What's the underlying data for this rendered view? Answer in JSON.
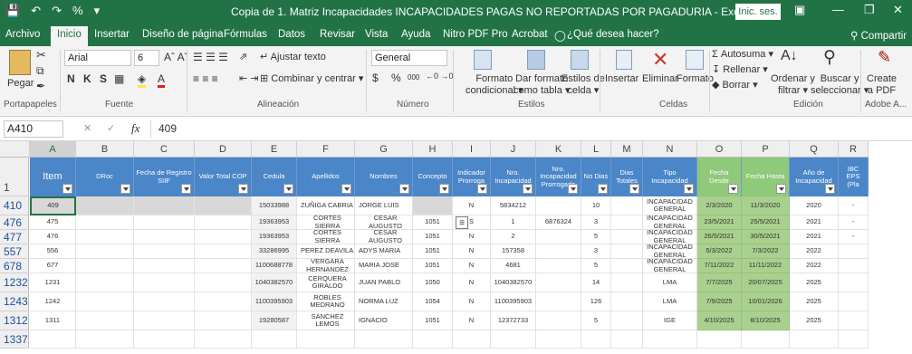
{
  "titlebar": {
    "title": "Copia de 1. Matriz Incapacidades INCAPACIDADES PAGAS NO REPORTADAS POR PAGADURIA  -  Excel",
    "signin": "Inic. ses."
  },
  "ribbon_tabs": [
    "Archivo",
    "Inicio",
    "Insertar",
    "Diseño de página",
    "Fórmulas",
    "Datos",
    "Revisar",
    "Vista",
    "Ayuda",
    "Nitro PDF Pro",
    "Acrobat",
    "¿Qué desea hacer?",
    "Compartir"
  ],
  "ribbon": {
    "paste": "Pegar",
    "font_name": "Arial",
    "font_size": "6",
    "bold_italic_underline": "N K S",
    "wrap_text": "Ajustar texto",
    "merge_center": "Combinar y centrar",
    "number_format": "General",
    "currency": "$",
    "percent": "%",
    "thousands": "000",
    "cond_format": [
      "Formato",
      "condicional"
    ],
    "format_table": [
      "Dar formato",
      "como tabla"
    ],
    "cell_styles": [
      "Estilos de",
      "celda"
    ],
    "insert": "Insertar",
    "delete": "Eliminar",
    "format": "Formato",
    "autosum": "Autosuma",
    "fill": "Rellenar",
    "clear": "Borrar",
    "sort_filter": [
      "Ordenar y",
      "filtrar"
    ],
    "find_select": [
      "Buscar y",
      "seleccionar"
    ],
    "create_pdf": [
      "Create",
      "a PDF"
    ],
    "groups": [
      "Portapapeles",
      "Fuente",
      "Alineación",
      "Número",
      "Estilos",
      "Celdas",
      "Edición",
      "Adobe A..."
    ]
  },
  "formula_bar": {
    "name_box": "A410",
    "fx": "fx",
    "value": "409"
  },
  "columns": [
    "A",
    "B",
    "C",
    "D",
    "E",
    "F",
    "G",
    "H",
    "I",
    "J",
    "K",
    "L",
    "M",
    "N",
    "O",
    "P",
    "Q",
    "R"
  ],
  "headers": [
    "Item",
    "DRoc",
    "Fecha de Registro SIIF",
    "Valor Total  COP",
    "Cedula",
    "Apellidos",
    "Nombres",
    "Concepto",
    "Indicador Prorroga",
    "Nro. Incapacidad",
    "Nro. Incapacidad Prorrogada",
    "No Dias",
    "Dias Totales",
    "Tipo Incapacidad",
    "Fecha Desde",
    "Fecha Hasta",
    "Año de Incapacidad",
    "IBC EPS (Pla"
  ],
  "header_row_number": "1",
  "rows": [
    {
      "num": "410",
      "cells": [
        "409",
        "",
        "",
        "",
        "15033988",
        "ZUÑIGA CABRIA",
        "JORGE LUIS",
        "",
        "N",
        "5834212",
        "",
        "10",
        "",
        "INCAPACIDAD GENERAL",
        "2/3/2020",
        "11/3/2020",
        "2020",
        "-"
      ]
    },
    {
      "num": "476",
      "cells": [
        "475",
        "",
        "",
        "",
        "19363953",
        "CORTES SIERRA",
        "CESAR AUGUSTO",
        "1051",
        "S",
        "1",
        "6876324",
        "3",
        "",
        "INCAPACIDAD GENERAL",
        "23/5/2021",
        "25/5/2021",
        "2021",
        "-"
      ]
    },
    {
      "num": "477",
      "cells": [
        "476",
        "",
        "",
        "",
        "19363953",
        "CORTES SIERRA",
        "CESAR AUGUSTO",
        "1051",
        "N",
        "2",
        "",
        "5",
        "",
        "INCAPACIDAD GENERAL",
        "26/5/2021",
        "30/5/2021",
        "2021",
        "-"
      ]
    },
    {
      "num": "557",
      "cells": [
        "556",
        "",
        "",
        "",
        "33286995",
        "PEREZ DEAVILA",
        "ADYS MARIA",
        "1051",
        "N",
        "157358",
        "",
        "3",
        "",
        "INCAPACIDAD GENERAL",
        "5/3/2022",
        "7/3/2022",
        "2022",
        ""
      ]
    },
    {
      "num": "678",
      "cells": [
        "677",
        "",
        "",
        "",
        "1100688778",
        "VERGARA HERNANDEZ",
        "MARIA JOSE",
        "1051",
        "N",
        "4681",
        "",
        "5",
        "",
        "INCAPACIDAD GENERAL",
        "7/11/2022",
        "11/11/2022",
        "2022",
        ""
      ]
    },
    {
      "num": "1232",
      "cells": [
        "1231",
        "",
        "",
        "",
        "1040382570",
        "CERQUERA GIRALDO",
        "JUAN PABLO",
        "1050",
        "N",
        "1040382570",
        "",
        "14",
        "",
        "LMA",
        "7/7/2025",
        "20/07/2025",
        "2025",
        ""
      ]
    },
    {
      "num": "1243",
      "cells": [
        "1242",
        "",
        "",
        "",
        "1100395903",
        "ROBLES MEDRANO",
        "NORMA LUZ",
        "1054",
        "N",
        "1100395903",
        "",
        "126",
        "",
        "LMA",
        "7/9/2025",
        "10/01/2026",
        "2025",
        ""
      ]
    },
    {
      "num": "1312",
      "cells": [
        "1311",
        "",
        "",
        "",
        "19280587",
        "SANCHEZ LEMOS",
        "IGNACIO",
        "1051",
        "N",
        "12372733",
        "",
        "5",
        "",
        "IGE",
        "4/10/2025",
        "8/10/2025",
        "2025",
        ""
      ]
    },
    {
      "num": "1337",
      "cells": [
        "",
        "",
        "",
        "",
        "",
        "",
        "",
        "",
        "",
        "",
        "",
        "",
        "",
        "",
        "",
        "",
        "",
        ""
      ]
    }
  ],
  "colors": {
    "excel_green": "#217346",
    "header_blue": "#4a86c8",
    "date_green": "#a9d08e"
  }
}
